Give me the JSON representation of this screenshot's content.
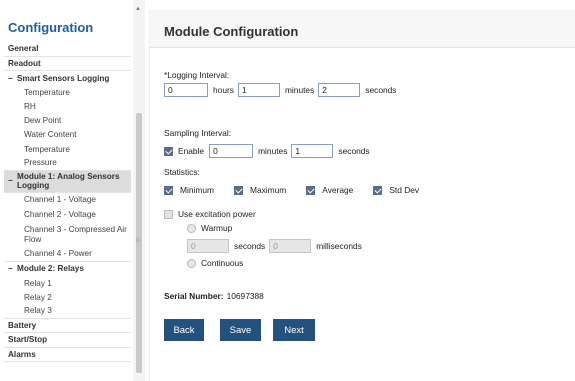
{
  "sidebar": {
    "title": "Configuration",
    "items": [
      {
        "label": "General"
      },
      {
        "label": "Readout"
      },
      {
        "label": "Smart Sensors Logging"
      },
      {
        "label": "Temperature"
      },
      {
        "label": "RH"
      },
      {
        "label": "Dew Point"
      },
      {
        "label": "Water Content"
      },
      {
        "label": "Temperature"
      },
      {
        "label": "Pressure"
      },
      {
        "label": "Module 1: Analog Sensors Logging"
      },
      {
        "label": "Channel 1 - Voltage"
      },
      {
        "label": "Channel 2 - Voltage"
      },
      {
        "label": "Channel 3 - Compressed Air Flow"
      },
      {
        "label": "Channel 4 - Power"
      },
      {
        "label": "Module 2: Relays"
      },
      {
        "label": "Relay 1"
      },
      {
        "label": "Relay 2"
      },
      {
        "label": "Relay 3"
      },
      {
        "label": "Battery"
      },
      {
        "label": "Start/Stop"
      },
      {
        "label": "Alarms"
      }
    ],
    "collapse_glyph": "−"
  },
  "main": {
    "title": "Module Configuration",
    "logging": {
      "label": "*Logging Interval:",
      "hours": "0",
      "hours_label": "hours",
      "minutes": "1",
      "minutes_label": "minutes",
      "seconds": "2",
      "seconds_label": "seconds"
    },
    "sampling": {
      "label": "Sampling Interval:",
      "enable_label": "Enable",
      "minutes": "0",
      "minutes_label": "minutes",
      "seconds": "1",
      "seconds_label": "seconds"
    },
    "statistics": {
      "label": "Statistics:",
      "minimum": "Minimum",
      "maximum": "Maximum",
      "average": "Average",
      "std_dev": "Std Dev"
    },
    "excitation": {
      "label": "Use excitation power",
      "warmup_label": "Warmup",
      "warmup_seconds": "0",
      "seconds_label": "seconds",
      "warmup_ms": "0",
      "milliseconds_label": "milliseconds",
      "continuous_label": "Continuous"
    },
    "serial": {
      "label": "Serial Number:",
      "value": "10697388"
    },
    "buttons": {
      "back": "Back",
      "save": "Save",
      "next": "Next"
    }
  },
  "colors": {
    "sidebar_title": "#1f5fa8",
    "button_bg": "#24517d",
    "checkbox_on": "#5a6d8a"
  }
}
